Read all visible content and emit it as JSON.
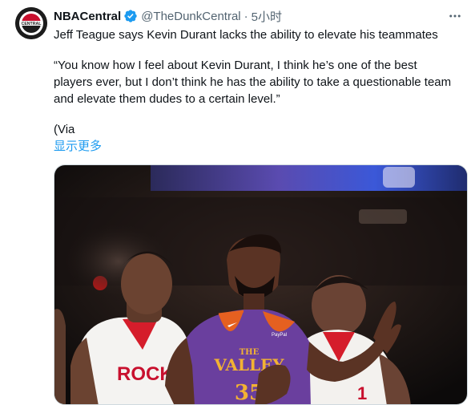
{
  "tweet": {
    "display_name": "NBACentral",
    "handle": "@TheDunkCentral",
    "separator": "·",
    "time": "5小时",
    "text_line1": "Jeff Teague says Kevin Durant lacks the ability to elevate his teammates",
    "quote_line1": "“You know how I feel about Kevin Durant, I think he’s one of the best",
    "quote_line2": "players ever, but I don’t think he has the ability to take a questionable team",
    "quote_line3": "and elevate them dudes to a certain level.”",
    "via": "(Via",
    "show_more": "显示更多"
  },
  "avatar": {
    "logo_text": "CENTRAL",
    "icon": "nba-central-logo"
  },
  "media": {
    "jersey_text_top": "THE",
    "jersey_text_main": "VALLEY",
    "jersey_number": "35",
    "rockets_text": "ROCKETS",
    "patch_text": "PayPal"
  },
  "colors": {
    "link": "#1d9bf0",
    "secondary_text": "#536471",
    "verified": "#1d9bf0",
    "jersey_purple": "#6a3f9e",
    "jersey_orange": "#e56020"
  }
}
